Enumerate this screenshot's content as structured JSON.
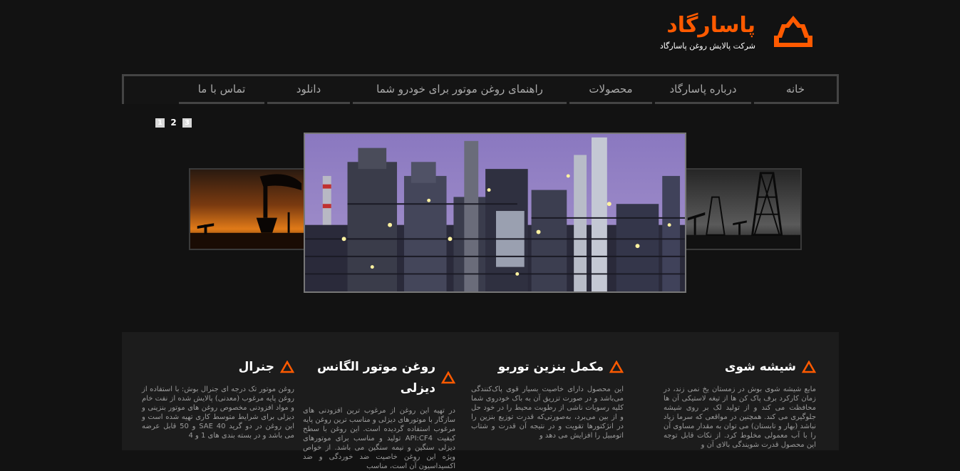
{
  "brand": {
    "title": "پاسارگاد",
    "subtitle": "شرکت پالایش روغن پاسارگاد",
    "accent_color": "#ff5a00",
    "logo_icon": "pyramid-logo-icon"
  },
  "nav": {
    "items": [
      {
        "label": "خانه"
      },
      {
        "label": "درباره پاسارگاد"
      },
      {
        "label": "محصولات"
      },
      {
        "label": "راهنمای روغن موتور برای خودرو شما"
      },
      {
        "label": "دانلود"
      },
      {
        "label": "تماس با ما"
      }
    ]
  },
  "pager": {
    "pages": [
      "1",
      "2",
      "3"
    ],
    "active": "2"
  },
  "slider": {
    "left_image": "sunset-oil-pump-image",
    "main_image": "refinery-night-image",
    "right_image": "oil-derricks-image"
  },
  "columns": [
    {
      "title": "شیشه شوی",
      "text": "مایع شیشه شوی بوش در زمستان یخ نمی زند، در زمان کارکرد برف پاک کن ها از تیغه لاستیکی آن ها محافظت می کند و از تولید لک بر روی شیشه جلوگیری می کند. همچنین در مواقعی که سرما زیاد نباشد (بهار و تابستان) می توان به مقدار مساوی آن را با آب معمولی مخلوط کرد. از نکات قابل توجه این محصول قدرت شویندگی بالای آن و"
    },
    {
      "title": "مکمل بنزین توربو",
      "text": "این محصول دارای خاصیت بسیار قوی پاک‌کنندگی می‌باشد و در صورت تزریق آن به باک خودروی شما کلیه رسوبات ناشی از رطوبت محیط را در خود حل و از بین می‌برد، به‌صورتی‌که قدرت توزیع بنزین را در انژکتورها تقویت و در نتیجه آن قدرت و شتاب اتومبیل را افزایش می دهد و"
    },
    {
      "title": "روغن موتور الگانس دیزلی",
      "text": "در تهیه این روغن از مرغوب ترین افزودنی های سازگار با موتورهای دیزلی و مناسب ترین روغن پایه مرغوب استفاده گردیده است. این روغن با سطح کیفیت API:CF4 تولید و مناسب برای موتورهای دیزلی سنگین و نیمه سنگین می باشد. از خواص ویژه این روغن خاصیت ضد خوردگی و ضد اکسیداسیون آن است، مناسب"
    },
    {
      "title": "جنرال",
      "text": "روغن موتور تک درجه ای جنرال بوش: با استفاده از روغن پایه مرغوب (معدنی) پالایش شده از نفت خام و مواد افزودنی مخصوص روغن های موتور بنزینی و دیزلی برای شرایط متوسط کاری تهیه شده است و این روغن در دو گرید SAE 40 و 50 قابل عرضه می باشد و در بسته بندی های 1 و 4"
    }
  ]
}
